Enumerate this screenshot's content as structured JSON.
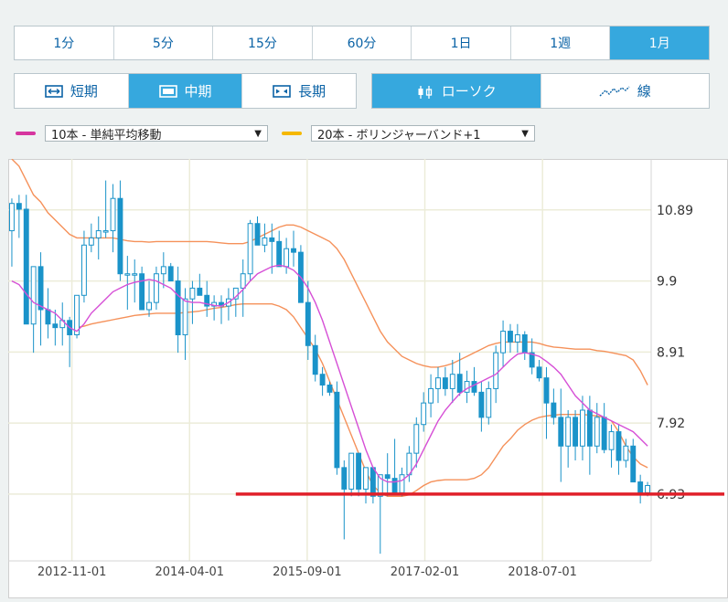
{
  "timeframes": [
    "1分",
    "5分",
    "15分",
    "60分",
    "1日",
    "1週",
    "1月"
  ],
  "active_timeframe": 6,
  "periods": [
    {
      "label": "短期",
      "icon": "short-term-icon"
    },
    {
      "label": "中期",
      "icon": "mid-term-icon"
    },
    {
      "label": "長期",
      "icon": "long-term-icon"
    }
  ],
  "active_period": 1,
  "chart_styles": [
    {
      "label": "ローソク",
      "icon": "candlestick-icon"
    },
    {
      "label": "線",
      "icon": "line-chart-icon"
    }
  ],
  "active_chart_style": 0,
  "indicators": {
    "first": {
      "label": "10本 - 単純平均移動",
      "color": "#d6369f"
    },
    "second": {
      "label": "20本 - ボリンジャーバンド+1",
      "color": "#f5b800"
    }
  },
  "chart_data": {
    "type": "candlestick",
    "x_ticks": [
      "2012-11-01",
      "2014-04-01",
      "2015-09-01",
      "2017-02-01",
      "2018-07-01"
    ],
    "y_ticks": [
      6.93,
      7.92,
      8.91,
      9.9,
      10.89
    ],
    "ylim": [
      6.0,
      11.6
    ],
    "grid": true,
    "colors": {
      "candle": "#1a93c9",
      "sma": "#d64fd6",
      "bollinger": "#f5915a",
      "support_line": "#e0202a",
      "grid": "#ececd9"
    },
    "candles": [
      [
        10.6,
        11.05,
        10.1,
        10.98
      ],
      [
        10.98,
        11.1,
        10.5,
        10.9
      ],
      [
        10.9,
        11.1,
        9.3,
        9.3
      ],
      [
        9.3,
        10.0,
        8.9,
        10.1
      ],
      [
        10.1,
        10.3,
        9.0,
        9.5
      ],
      [
        9.5,
        9.8,
        9.1,
        9.3
      ],
      [
        9.3,
        9.5,
        9.0,
        9.25
      ],
      [
        9.25,
        9.6,
        9.0,
        9.35
      ],
      [
        9.35,
        9.4,
        8.7,
        9.15
      ],
      [
        9.15,
        9.7,
        9.1,
        9.7
      ],
      [
        9.7,
        10.6,
        9.6,
        10.4
      ],
      [
        10.4,
        10.7,
        10.3,
        10.5
      ],
      [
        10.5,
        10.8,
        10.2,
        10.6
      ],
      [
        10.6,
        11.3,
        10.5,
        10.6
      ],
      [
        10.6,
        11.25,
        10.3,
        11.05
      ],
      [
        11.05,
        11.3,
        9.9,
        10.0
      ],
      [
        10.0,
        10.25,
        9.5,
        10.0
      ],
      [
        10.0,
        10.2,
        9.6,
        10.0
      ],
      [
        10.0,
        10.1,
        9.5,
        9.5
      ],
      [
        9.5,
        9.9,
        9.4,
        9.6
      ],
      [
        9.6,
        10.1,
        9.5,
        10.0
      ],
      [
        10.0,
        10.3,
        9.8,
        10.1
      ],
      [
        10.1,
        10.15,
        9.95,
        9.9
      ],
      [
        9.9,
        10.1,
        8.9,
        9.15
      ],
      [
        9.15,
        9.8,
        8.8,
        9.65
      ],
      [
        9.65,
        9.9,
        9.3,
        9.8
      ],
      [
        9.8,
        10.0,
        9.7,
        9.7
      ],
      [
        9.7,
        9.9,
        9.4,
        9.55
      ],
      [
        9.55,
        9.7,
        9.35,
        9.6
      ],
      [
        9.6,
        9.7,
        9.3,
        9.55
      ],
      [
        9.55,
        9.8,
        9.35,
        9.65
      ],
      [
        9.65,
        9.8,
        9.4,
        9.8
      ],
      [
        9.8,
        10.2,
        9.4,
        10.0
      ],
      [
        10.0,
        10.75,
        9.9,
        10.7
      ],
      [
        10.7,
        10.8,
        10.4,
        10.4
      ],
      [
        10.4,
        10.7,
        10.3,
        10.5
      ],
      [
        10.5,
        10.7,
        10.0,
        10.45
      ],
      [
        10.45,
        10.6,
        10.1,
        10.1
      ],
      [
        10.1,
        10.5,
        10.0,
        10.35
      ],
      [
        10.35,
        10.6,
        10.1,
        10.3
      ],
      [
        10.3,
        10.4,
        9.6,
        9.6
      ],
      [
        9.6,
        9.9,
        8.8,
        9.0
      ],
      [
        9.0,
        9.15,
        8.5,
        8.6
      ],
      [
        8.6,
        8.7,
        8.3,
        8.45
      ],
      [
        8.45,
        8.5,
        8.3,
        8.35
      ],
      [
        8.35,
        8.5,
        7.2,
        7.3
      ],
      [
        7.3,
        7.4,
        6.3,
        7.0
      ],
      [
        7.0,
        7.4,
        6.9,
        7.5
      ],
      [
        7.5,
        7.5,
        6.9,
        7.0
      ],
      [
        7.0,
        7.3,
        6.8,
        7.3
      ],
      [
        7.3,
        7.3,
        6.8,
        6.9
      ],
      [
        6.9,
        7.1,
        6.1,
        7.2
      ],
      [
        7.2,
        7.5,
        6.9,
        7.15
      ],
      [
        7.15,
        7.7,
        7.0,
        6.95
      ],
      [
        6.95,
        7.3,
        6.9,
        7.2
      ],
      [
        7.2,
        7.6,
        7.1,
        7.5
      ],
      [
        7.5,
        8.0,
        7.3,
        7.9
      ],
      [
        7.9,
        8.35,
        7.8,
        8.2
      ],
      [
        8.2,
        8.6,
        8.0,
        8.4
      ],
      [
        8.4,
        8.7,
        8.2,
        8.55
      ],
      [
        8.55,
        8.7,
        8.3,
        8.4
      ],
      [
        8.4,
        8.8,
        8.2,
        8.6
      ],
      [
        8.6,
        8.9,
        8.3,
        8.35
      ],
      [
        8.35,
        8.65,
        8.2,
        8.5
      ],
      [
        8.5,
        8.7,
        8.3,
        8.35
      ],
      [
        8.35,
        8.5,
        7.8,
        8.0
      ],
      [
        8.0,
        8.5,
        7.9,
        8.4
      ],
      [
        8.4,
        9.0,
        8.2,
        8.9
      ],
      [
        8.9,
        9.35,
        8.7,
        9.2
      ],
      [
        9.2,
        9.3,
        8.9,
        9.05
      ],
      [
        9.05,
        9.3,
        8.9,
        9.15
      ],
      [
        9.15,
        9.2,
        8.8,
        8.9
      ],
      [
        8.9,
        9.1,
        8.6,
        8.7
      ],
      [
        8.7,
        8.8,
        8.5,
        8.55
      ],
      [
        8.55,
        8.7,
        7.7,
        8.2
      ],
      [
        8.2,
        8.4,
        7.9,
        8.0
      ],
      [
        8.0,
        8.4,
        7.1,
        7.6
      ],
      [
        7.6,
        8.1,
        7.3,
        8.0
      ],
      [
        8.0,
        8.1,
        7.4,
        7.6
      ],
      [
        7.6,
        8.3,
        7.4,
        8.1
      ],
      [
        8.1,
        8.3,
        7.2,
        7.6
      ],
      [
        7.6,
        8.2,
        7.5,
        8.0
      ],
      [
        8.0,
        8.2,
        7.5,
        7.55
      ],
      [
        7.55,
        7.9,
        7.3,
        7.8
      ],
      [
        7.8,
        7.9,
        7.2,
        7.4
      ],
      [
        7.4,
        7.7,
        7.3,
        7.6
      ],
      [
        7.6,
        7.7,
        7.1,
        7.1
      ],
      [
        7.1,
        7.2,
        6.8,
        6.95
      ],
      [
        6.95,
        7.1,
        6.9,
        7.05
      ]
    ],
    "sma": [
      9.9,
      9.85,
      9.72,
      9.6,
      9.55,
      9.5,
      9.45,
      9.35,
      9.25,
      9.2,
      9.3,
      9.45,
      9.55,
      9.65,
      9.75,
      9.8,
      9.85,
      9.88,
      9.9,
      9.92,
      9.9,
      9.85,
      9.8,
      9.7,
      9.62,
      9.6,
      9.6,
      9.58,
      9.56,
      9.55,
      9.6,
      9.68,
      9.78,
      9.9,
      10.0,
      10.05,
      10.1,
      10.12,
      10.1,
      10.05,
      9.95,
      9.8,
      9.6,
      9.35,
      9.05,
      8.75,
      8.45,
      8.15,
      7.85,
      7.55,
      7.3,
      7.15,
      7.1,
      7.1,
      7.12,
      7.2,
      7.35,
      7.55,
      7.75,
      7.95,
      8.1,
      8.22,
      8.33,
      8.4,
      8.45,
      8.5,
      8.55,
      8.6,
      8.7,
      8.8,
      8.88,
      8.9,
      8.88,
      8.85,
      8.78,
      8.7,
      8.6,
      8.45,
      8.3,
      8.2,
      8.1,
      8.05,
      8.0,
      7.95,
      7.9,
      7.85,
      7.8,
      7.7,
      7.6
    ],
    "bb_upper": [
      11.6,
      11.5,
      11.3,
      11.1,
      11.0,
      10.85,
      10.75,
      10.65,
      10.55,
      10.5,
      10.5,
      10.5,
      10.5,
      10.5,
      10.5,
      10.48,
      10.46,
      10.45,
      10.45,
      10.44,
      10.45,
      10.45,
      10.45,
      10.45,
      10.45,
      10.45,
      10.45,
      10.45,
      10.44,
      10.43,
      10.42,
      10.42,
      10.42,
      10.45,
      10.5,
      10.55,
      10.6,
      10.65,
      10.68,
      10.68,
      10.65,
      10.6,
      10.55,
      10.5,
      10.45,
      10.35,
      10.2,
      10.0,
      9.8,
      9.6,
      9.4,
      9.2,
      9.05,
      8.95,
      8.85,
      8.8,
      8.75,
      8.72,
      8.7,
      8.7,
      8.72,
      8.75,
      8.8,
      8.85,
      8.9,
      8.95,
      9.0,
      9.03,
      9.05,
      9.05,
      9.05,
      9.05,
      9.05,
      9.03,
      9.0,
      8.98,
      8.97,
      8.96,
      8.95,
      8.95,
      8.95,
      8.93,
      8.92,
      8.9,
      8.88,
      8.86,
      8.8,
      8.65,
      8.45
    ],
    "bb_lower": [
      null,
      null,
      null,
      null,
      null,
      null,
      null,
      null,
      null,
      9.25,
      9.27,
      9.3,
      9.32,
      9.34,
      9.36,
      9.38,
      9.4,
      9.42,
      9.43,
      9.44,
      9.45,
      9.45,
      9.45,
      9.45,
      9.46,
      9.47,
      9.48,
      9.5,
      9.52,
      9.53,
      9.55,
      9.57,
      9.58,
      9.58,
      9.58,
      9.58,
      9.58,
      9.55,
      9.5,
      9.4,
      9.25,
      9.1,
      8.95,
      8.75,
      8.5,
      8.25,
      8.0,
      7.75,
      7.5,
      7.25,
      7.05,
      6.95,
      6.9,
      6.9,
      6.9,
      6.92,
      6.98,
      7.05,
      7.1,
      7.12,
      7.13,
      7.13,
      7.13,
      7.13,
      7.15,
      7.2,
      7.3,
      7.45,
      7.6,
      7.7,
      7.82,
      7.9,
      7.96,
      8.0,
      8.02,
      8.03,
      8.04,
      8.04,
      8.04,
      8.04,
      8.03,
      8.02,
      8.0,
      7.95,
      7.8,
      7.6,
      7.45,
      7.35,
      7.3
    ],
    "support_line": {
      "from_index": 31,
      "value": 6.93
    }
  }
}
